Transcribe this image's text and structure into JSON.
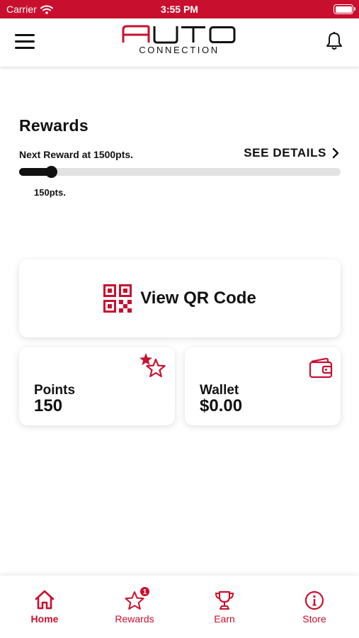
{
  "status_bar": {
    "carrier": "Carrier",
    "time": "3:55 PM"
  },
  "header": {
    "menu_icon": "hamburger-menu-icon",
    "logo_top": "AUTO",
    "logo_bottom": "CONNECTION",
    "bell_icon": "bell-icon"
  },
  "rewards": {
    "title": "Rewards",
    "next_reward_text": "Next Reward at 1500pts.",
    "see_details_label": "SEE DETAILS",
    "progress_fraction": 0.1,
    "current_points_text": "150pts."
  },
  "qr_card": {
    "label": "View QR Code",
    "icon": "qr-code-icon"
  },
  "points_card": {
    "label": "Points",
    "value": "150",
    "icon": "stars-icon"
  },
  "wallet_card": {
    "label": "Wallet",
    "value": "$0.00",
    "icon": "wallet-icon"
  },
  "tab_bar": {
    "tabs": [
      {
        "label": "Home",
        "icon": "home-icon",
        "active": true
      },
      {
        "label": "Rewards",
        "icon": "star-icon",
        "badge": "1"
      },
      {
        "label": "Earn",
        "icon": "trophy-icon"
      },
      {
        "label": "Store",
        "icon": "info-icon"
      }
    ]
  },
  "colors": {
    "brand_red": "#c8102e",
    "text_dark": "#111111",
    "track_gray": "#e2e2e2"
  }
}
